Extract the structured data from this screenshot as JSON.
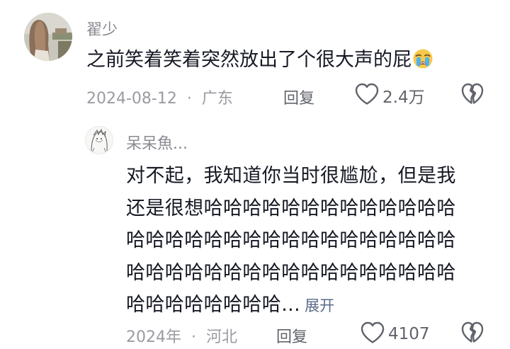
{
  "comment": {
    "username": "翟少",
    "text": "之前笑着笑着突然放出了个很大声的屁",
    "emoji": "loudly-crying-face",
    "date": "2024-08-12",
    "separator": "·",
    "location": "广东",
    "reply_label": "回复",
    "like_count": "2.4万"
  },
  "reply": {
    "username": "呆呆魚...",
    "lines": [
      "对不起，我知道你当时很尴尬，但是我",
      "还是很想哈哈哈哈哈哈哈哈哈哈哈哈哈",
      "哈哈哈哈哈哈哈哈哈哈哈哈哈哈哈哈哈",
      "哈哈哈哈哈哈哈哈哈哈哈哈哈哈哈哈哈",
      "哈哈哈哈哈哈哈哈..."
    ],
    "expand_label": "展开",
    "date": "2024年",
    "separator": "·",
    "location": "河北",
    "reply_label": "回复",
    "like_count": "4107"
  },
  "colors": {
    "text_primary": "#161823",
    "text_secondary": "#8a8b91",
    "expand_link": "#5a6a8a"
  }
}
